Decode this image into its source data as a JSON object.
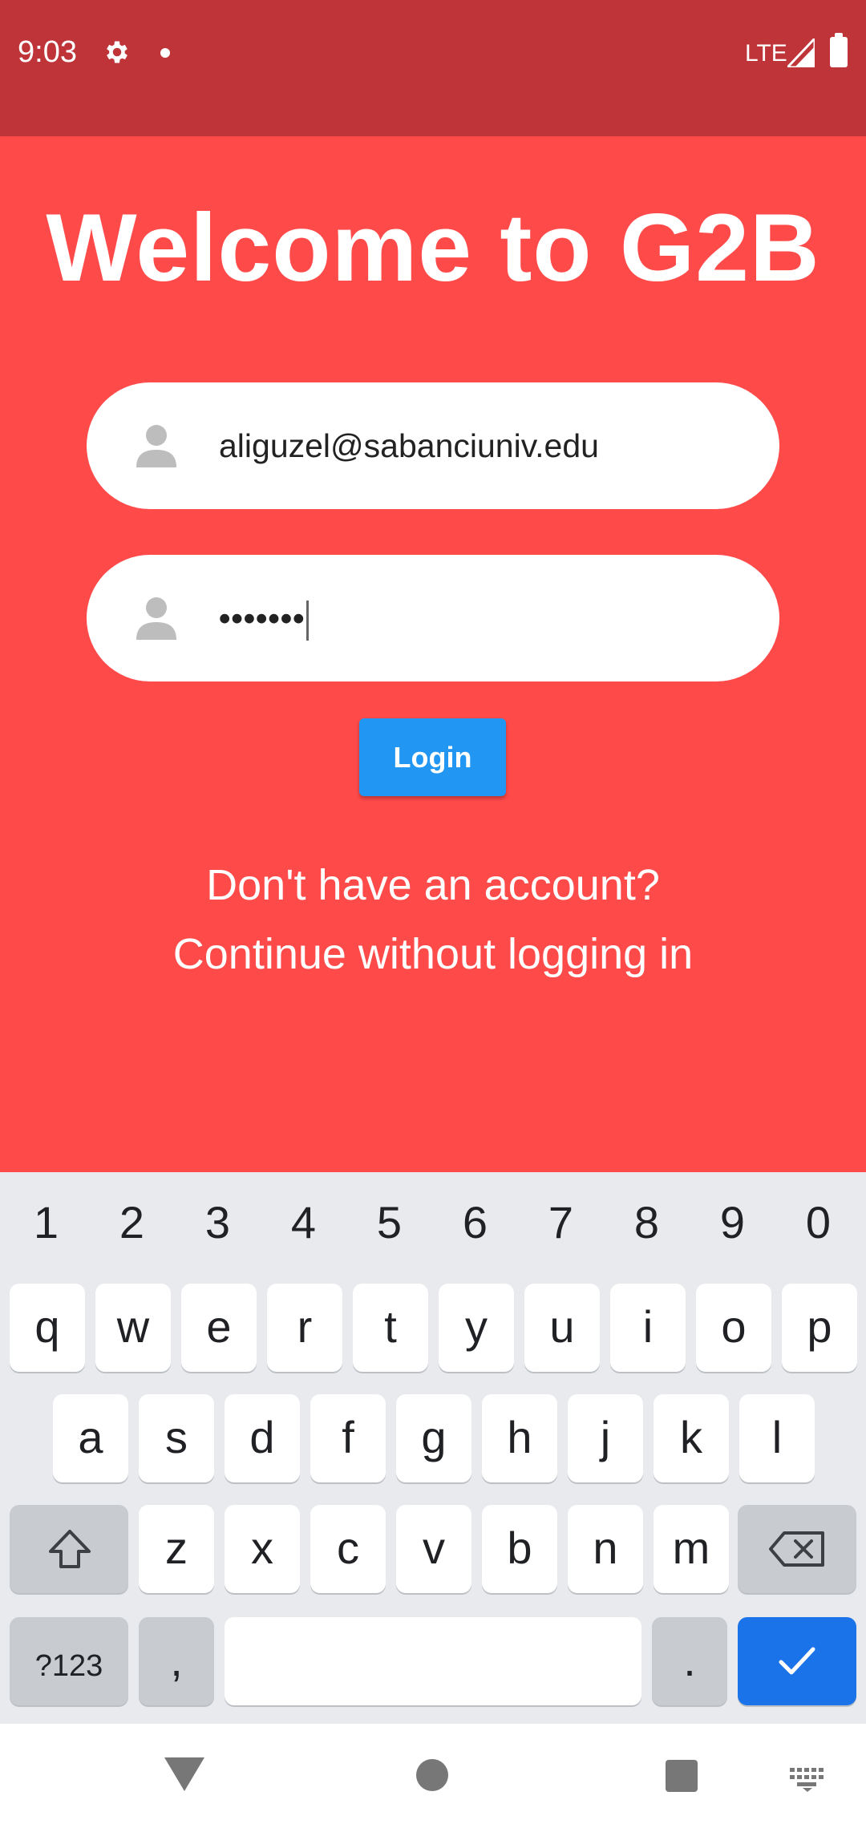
{
  "status_bar": {
    "time": "9:03",
    "network": "LTE",
    "icons": [
      "gear-icon",
      "notification-dot-icon",
      "signal-icon",
      "battery-icon"
    ]
  },
  "login_screen": {
    "title": "Welcome to G2B",
    "email_field": {
      "value": "aliguzel@sabanciuniv.edu",
      "icon": "person-icon"
    },
    "password_field": {
      "value": "•••••••",
      "icon": "person-icon"
    },
    "login_button": "Login",
    "signup_link": "Don't have an account?",
    "guest_link": "Continue without logging in"
  },
  "keyboard": {
    "number_row": [
      "1",
      "2",
      "3",
      "4",
      "5",
      "6",
      "7",
      "8",
      "9",
      "0"
    ],
    "row1": [
      "q",
      "w",
      "e",
      "r",
      "t",
      "y",
      "u",
      "i",
      "o",
      "p"
    ],
    "row2": [
      "a",
      "s",
      "d",
      "f",
      "g",
      "h",
      "j",
      "k",
      "l"
    ],
    "row3": [
      "z",
      "x",
      "c",
      "v",
      "b",
      "n",
      "m"
    ],
    "symbols_key": "?123",
    "comma_key": ",",
    "period_key": ".",
    "icons": [
      "shift-icon",
      "backspace-icon",
      "checkmark-icon"
    ]
  },
  "nav_bar": {
    "icons": [
      "back-icon",
      "home-icon",
      "recents-icon",
      "keyboard-switch-icon"
    ]
  },
  "colors": {
    "status_bar": "#BF3438",
    "background": "#FF4A4A",
    "login_button": "#2196F3",
    "keyboard_action": "#1A73E8",
    "keyboard_bg": "#E8EAED"
  }
}
